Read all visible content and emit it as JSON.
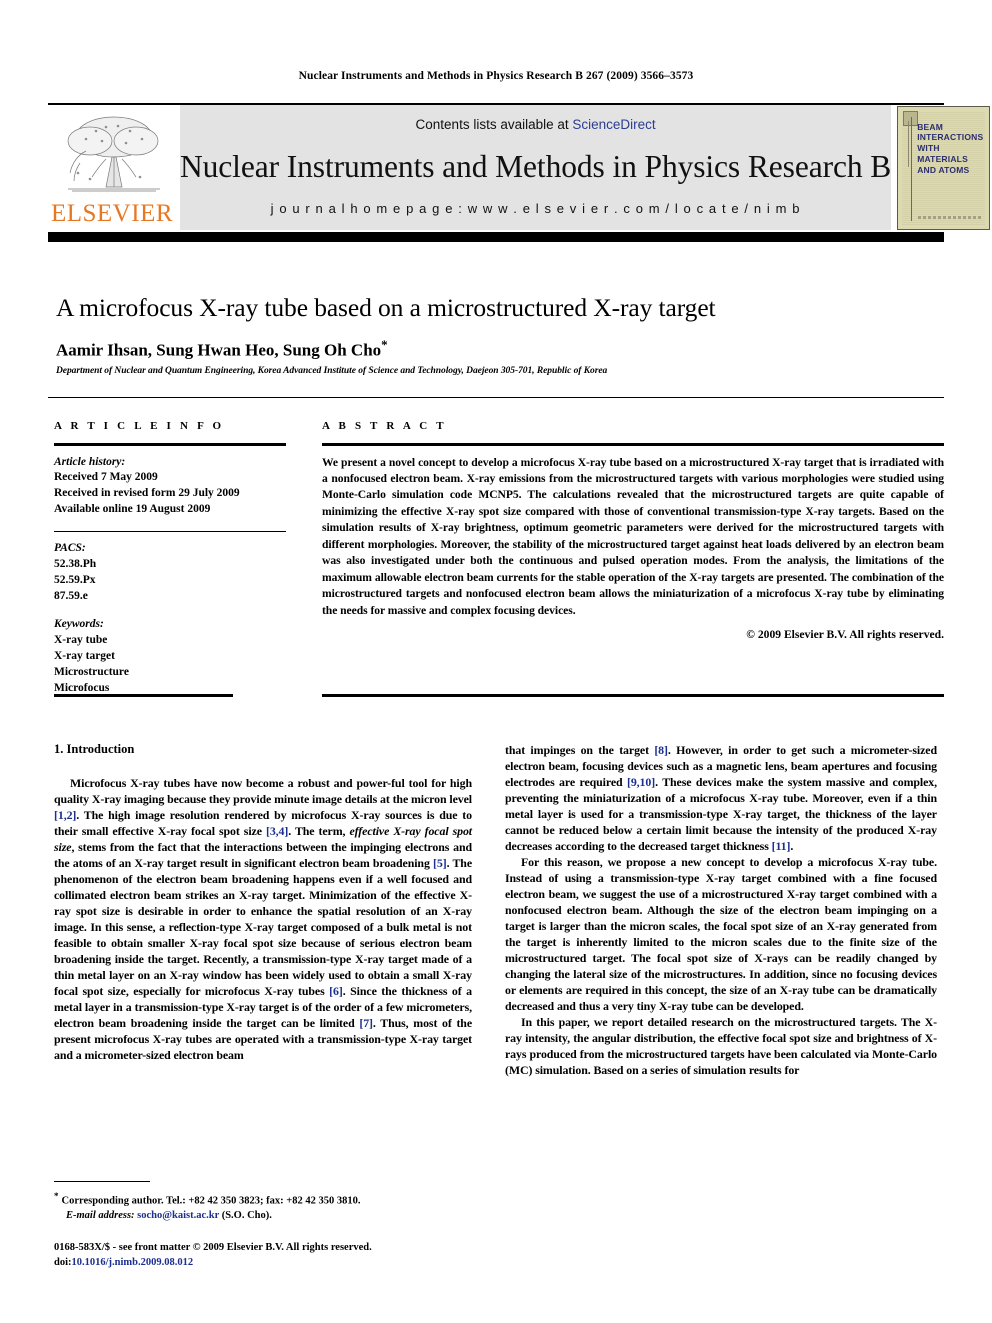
{
  "running_head": "Nuclear Instruments and Methods in Physics Research B 267 (2009) 3566–3573",
  "masthead": {
    "publisher": "ELSEVIER",
    "contents_prefix": "Contents lists available at ",
    "contents_link": "ScienceDirect",
    "journal_title": "Nuclear Instruments and Methods in Physics Research B",
    "homepage": "j o u r n a l   h o m e p a g e :   w w w . e l s e v i e r . c o m / l o c a t e / n i m b",
    "cover_text": "BEAM\nINTERACTIONS\nWITH\nMATERIALS\nAND ATOMS"
  },
  "title": "A microfocus X-ray tube based on a microstructured X-ray target",
  "authors": "Aamir Ihsan, Sung Hwan Heo, Sung Oh Cho",
  "author_star": "*",
  "affiliation": "Department of Nuclear and Quantum Engineering, Korea Advanced Institute of Science and Technology, Daejeon 305-701, Republic of Korea",
  "article_info": {
    "heading": "A R T I C L E   I N F O",
    "history_label": "Article history:",
    "history": [
      "Received 7 May 2009",
      "Received in revised form 29 July 2009",
      "Available online 19 August 2009"
    ],
    "pacs_label": "PACS:",
    "pacs": [
      "52.38.Ph",
      "52.59.Px",
      "87.59.e"
    ],
    "keywords_label": "Keywords:",
    "keywords": [
      "X-ray tube",
      "X-ray target",
      "Microstructure",
      "Microfocus"
    ]
  },
  "abstract": {
    "heading": "A B S T R A C T",
    "text": "We present a novel concept to develop a microfocus X-ray tube based on a microstructured X-ray target that is irradiated with a nonfocused electron beam. X-ray emissions from the microstructured targets with various morphologies were studied using Monte-Carlo simulation code MCNP5. The calculations revealed that the microstructured targets are quite capable of minimizing the effective X-ray spot size compared with those of conventional transmission-type X-ray targets. Based on the simulation results of X-ray brightness, optimum geometric parameters were derived for the microstructured targets with different morphologies. Moreover, the stability of the microstructured target against heat loads delivered by an electron beam was also investigated under both the continuous and pulsed operation modes. From the analysis, the limitations of the maximum allowable electron beam currents for the stable operation of the X-ray targets are presented. The combination of the microstructured targets and nonfocused electron beam allows the miniaturization of a microfocus X-ray tube by eliminating the needs for massive and complex focusing devices.",
    "copyright": "© 2009 Elsevier B.V. All rights reserved."
  },
  "body": {
    "section_title": "1. Introduction",
    "left_paragraph_1_a": "Microfocus X-ray tubes have now become a robust and power-ful tool for high quality X-ray imaging because they provide minute image details at the micron level ",
    "ref_12": "[1,2]",
    "left_paragraph_1_b": ". The high image resolution rendered by microfocus X-ray sources is due to their small effective X-ray focal spot size ",
    "ref_34": "[3,4]",
    "left_paragraph_1_c": ". The term, ",
    "ital_effective": "effective X-ray focal spot size",
    "left_paragraph_1_d": ", stems from the fact that the interactions between the impinging electrons and the atoms of an X-ray target result in significant electron beam broadening ",
    "ref_5": "[5]",
    "left_paragraph_1_e": ". The phenomenon of the electron beam broadening happens even if a well focused and collimated electron beam strikes an X-ray target. Minimization of the effective X-ray spot size is desirable in order to enhance the spatial resolution of an X-ray image. In this sense, a reflection-type X-ray target composed of a bulk metal is not feasible to obtain smaller X-ray focal spot size because of serious electron beam broadening inside the target. Recently, a transmission-type X-ray target made of a thin metal layer on an X-ray window has been widely used to obtain a small X-ray focal spot size, especially for microfocus X-ray tubes ",
    "ref_6": "[6]",
    "left_paragraph_1_f": ". Since the thickness of a metal layer in a transmission-type X-ray target is of the order of a few micrometers, electron beam broadening inside the target can be limited ",
    "ref_7": "[7]",
    "left_paragraph_1_g": ". Thus, most of the present microfocus X-ray tubes are operated with a transmission-type X-ray target and a micrometer-sized electron beam",
    "right_paragraph_1_a": "that impinges on the target ",
    "ref_8": "[8]",
    "right_paragraph_1_b": ". However, in order to get such a micrometer-sized electron beam, focusing devices such as a magnetic lens, beam apertures and focusing electrodes are required ",
    "ref_910": "[9,10]",
    "right_paragraph_1_c": ". These devices make the system massive and complex, preventing the miniaturization of a microfocus X-ray tube. Moreover, even if a thin metal layer is used for a transmission-type X-ray target, the thickness of the layer cannot be reduced below a certain limit because the intensity of the produced X-ray decreases according to the decreased target thickness ",
    "ref_11": "[11]",
    "right_paragraph_1_d": ".",
    "right_paragraph_2": "For this reason, we propose a new concept to develop a microfocus X-ray tube. Instead of using a transmission-type X-ray target combined with a fine focused electron beam, we suggest the use of a microstructured X-ray target combined with a nonfocused electron beam. Although the size of the electron beam impinging on a target is larger than the micron scales, the focal spot size of an X-ray generated from the target is inherently limited to the micron scales due to the finite size of the microstructured target. The focal spot size of X-rays can be readily changed by changing the lateral size of the microstructures. In addition, since no focusing devices or elements are required in this concept, the size of an X-ray tube can be dramatically decreased and thus a very tiny X-ray tube can be developed.",
    "right_paragraph_3": "In this paper, we report detailed research on the microstructured targets. The X-ray intensity, the angular distribution, the effective focal spot size and brightness of X-rays produced from the microstructured targets have been calculated via Monte-Carlo (MC) simulation. Based on a series of simulation results for"
  },
  "footer": {
    "star": "*",
    "corresponding": "Corresponding author. Tel.: +82 42 350 3823; fax: +82 42 350 3810.",
    "email_label": "E-mail address:",
    "email": "socho@kaist.ac.kr",
    "email_suffix": "(S.O. Cho).",
    "frontmatter": "0168-583X/$ - see front matter © 2009 Elsevier B.V. All rights reserved.",
    "doi_label": "doi:",
    "doi": "10.1016/j.nimb.2009.08.012"
  }
}
